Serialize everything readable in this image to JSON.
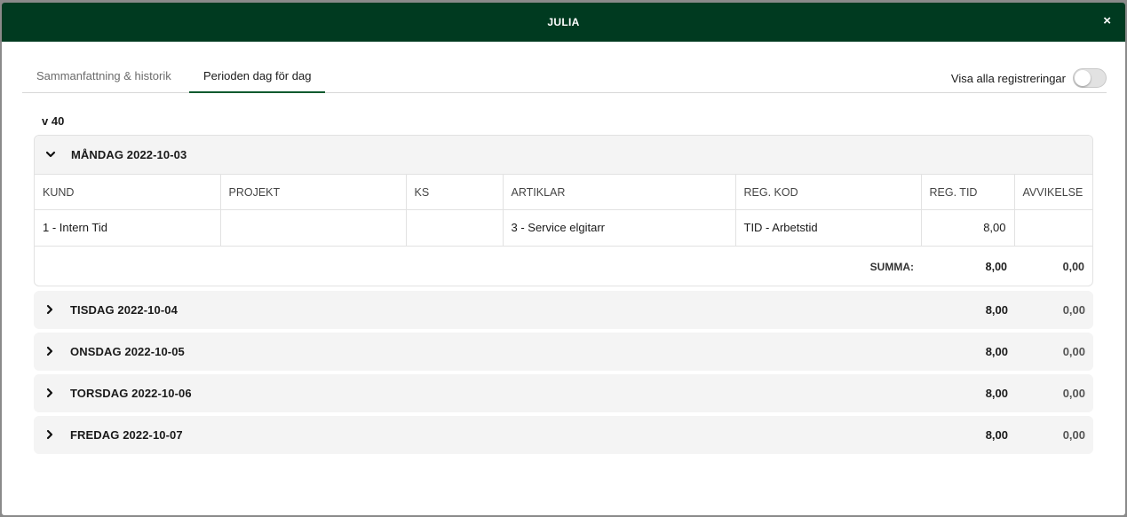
{
  "header": {
    "title": "JULIA",
    "close_label": "×"
  },
  "tabs": [
    {
      "label": "Sammanfattning & historik",
      "active": false
    },
    {
      "label": "Perioden dag för dag",
      "active": true
    }
  ],
  "toggle": {
    "label": "Visa alla registreringar",
    "on": false
  },
  "week_label": "v 40",
  "open_day": {
    "title": "MÅNDAG 2022-10-03",
    "columns": [
      "KUND",
      "PROJEKT",
      "KS",
      "ARTIKLAR",
      "REG. KOD",
      "REG. TID",
      "AVVIKELSE"
    ],
    "rows": [
      [
        "1 - Intern Tid",
        "",
        "",
        "3 - Service elgitarr",
        "TID - Arbetstid",
        "8,00",
        ""
      ]
    ],
    "sum_label": "SUMMA:",
    "sum_reg_tid": "8,00",
    "sum_avvikelse": "0,00"
  },
  "closed_days": [
    {
      "title": "TISDAG 2022-10-04",
      "reg_tid": "8,00",
      "avvikelse": "0,00"
    },
    {
      "title": "ONSDAG 2022-10-05",
      "reg_tid": "8,00",
      "avvikelse": "0,00"
    },
    {
      "title": "TORSDAG 2022-10-06",
      "reg_tid": "8,00",
      "avvikelse": "0,00"
    },
    {
      "title": "FREDAG 2022-10-07",
      "reg_tid": "8,00",
      "avvikelse": "0,00"
    }
  ]
}
